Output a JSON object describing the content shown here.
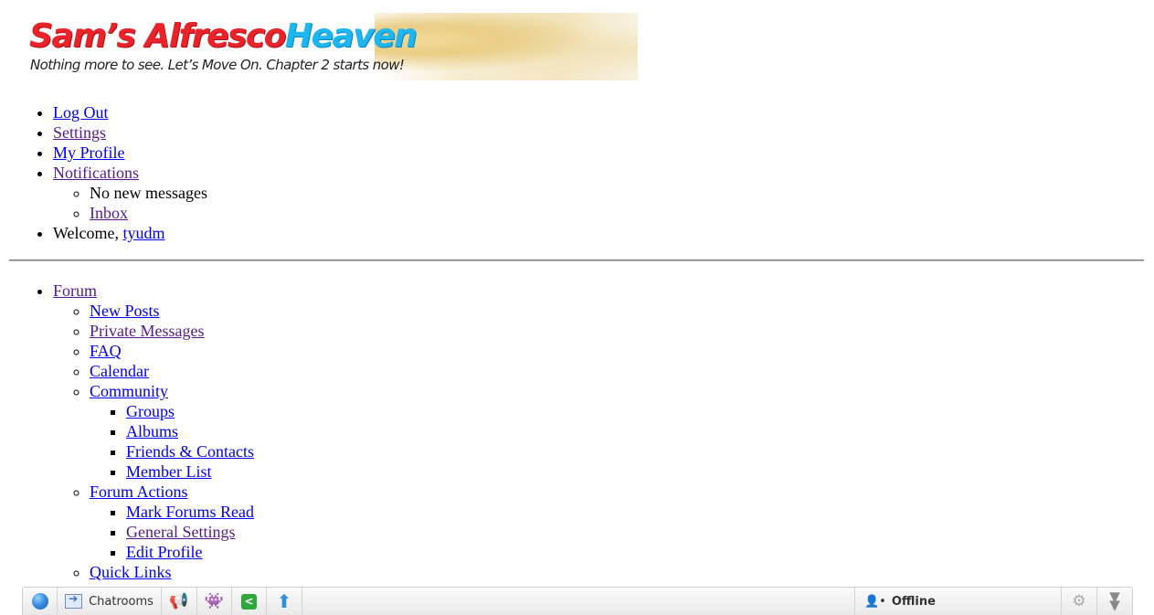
{
  "banner": {
    "title_part1": "Sam’s Alfresco",
    "title_part2": "Heaven",
    "tagline": "Nothing more to see. Let’s Move On. Chapter 2 starts now!",
    "colors": {
      "title_red": "#e8242a",
      "title_blue": "#1eb6ee"
    }
  },
  "top_menu": {
    "log_out": "Log Out",
    "settings": "Settings",
    "my_profile": "My Profile",
    "notifications": "Notifications",
    "notifications_sub": {
      "no_new_messages": "No new messages",
      "inbox": "Inbox"
    },
    "welcome_prefix": "Welcome, ",
    "username": "tyudm"
  },
  "nav_menu": {
    "forum": "Forum",
    "items": {
      "new_posts": "New Posts",
      "private_messages": "Private Messages",
      "faq": "FAQ",
      "calendar": "Calendar",
      "community": "Community",
      "community_sub": {
        "groups": "Groups",
        "albums": "Albums",
        "friends_contacts": "Friends & Contacts",
        "member_list": "Member List"
      },
      "forum_actions": "Forum Actions",
      "forum_actions_sub": {
        "mark_forums_read": "Mark Forums Read",
        "general_settings": "General Settings",
        "edit_profile": "Edit Profile"
      },
      "quick_links": "Quick Links"
    }
  },
  "chatbar": {
    "chatrooms_label": "Chatrooms",
    "status_label": "Offline",
    "icons": [
      "globe-icon",
      "chatrooms-icon",
      "megaphone-icon",
      "invader-icon",
      "share-icon",
      "upload-arrow-icon",
      "user-status-icon",
      "gear-icon",
      "collapse-icon"
    ]
  },
  "colors": {
    "link": "#0000ee",
    "visited_link": "#551a8b"
  }
}
